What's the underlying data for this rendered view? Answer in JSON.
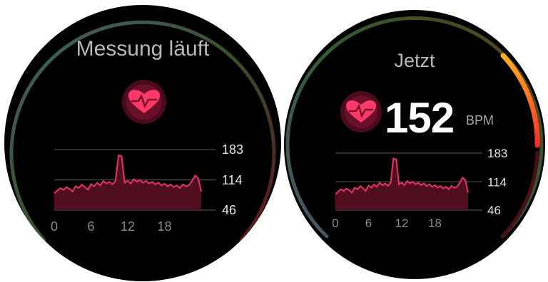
{
  "measuring_screen": {
    "title": "Messung läuft",
    "y_ticks": [
      "183",
      "114",
      "46"
    ],
    "x_ticks": [
      "0",
      "6",
      "12",
      "18"
    ]
  },
  "now_screen": {
    "title": "Jetzt",
    "heart_rate": "152",
    "unit": "BPM",
    "y_ticks": [
      "183",
      "114",
      "46"
    ],
    "x_ticks": [
      "0",
      "6",
      "12",
      "18"
    ],
    "gauge_level_fraction": 0.68
  },
  "chart_data": {
    "type": "area",
    "title": "",
    "xlabel": "",
    "ylabel": "",
    "x_range": [
      0,
      24
    ],
    "ylim": [
      46,
      183
    ],
    "x_ticks": [
      0,
      6,
      12,
      18
    ],
    "y_ticks": [
      46,
      114,
      183
    ],
    "x": [
      0,
      0.5,
      1,
      1.5,
      2,
      2.5,
      3,
      3.5,
      4,
      4.5,
      5,
      5.5,
      6,
      6.5,
      7,
      7.5,
      8,
      8.5,
      9,
      9.5,
      10,
      10.5,
      11,
      11.5,
      12,
      12.5,
      13,
      13.5,
      14,
      14.5,
      15,
      15.5,
      16,
      16.5,
      17,
      17.5,
      18,
      18.5,
      19,
      19.5,
      20,
      20.5,
      21,
      21.5,
      22,
      22.5,
      23,
      23.5,
      24
    ],
    "values": [
      84,
      90,
      96,
      92,
      98,
      94,
      88,
      100,
      96,
      104,
      98,
      92,
      105,
      100,
      108,
      102,
      112,
      106,
      110,
      104,
      112,
      170,
      168,
      108,
      112,
      106,
      116,
      110,
      114,
      108,
      112,
      106,
      110,
      104,
      108,
      102,
      106,
      100,
      104,
      98,
      102,
      96,
      104,
      100,
      102,
      112,
      124,
      118,
      88
    ],
    "colors": {
      "line": "#e8336a",
      "fill": "#5a0f22",
      "accent": "#ff2a55"
    }
  },
  "icons": {
    "heart": "heart-pulse-icon"
  }
}
